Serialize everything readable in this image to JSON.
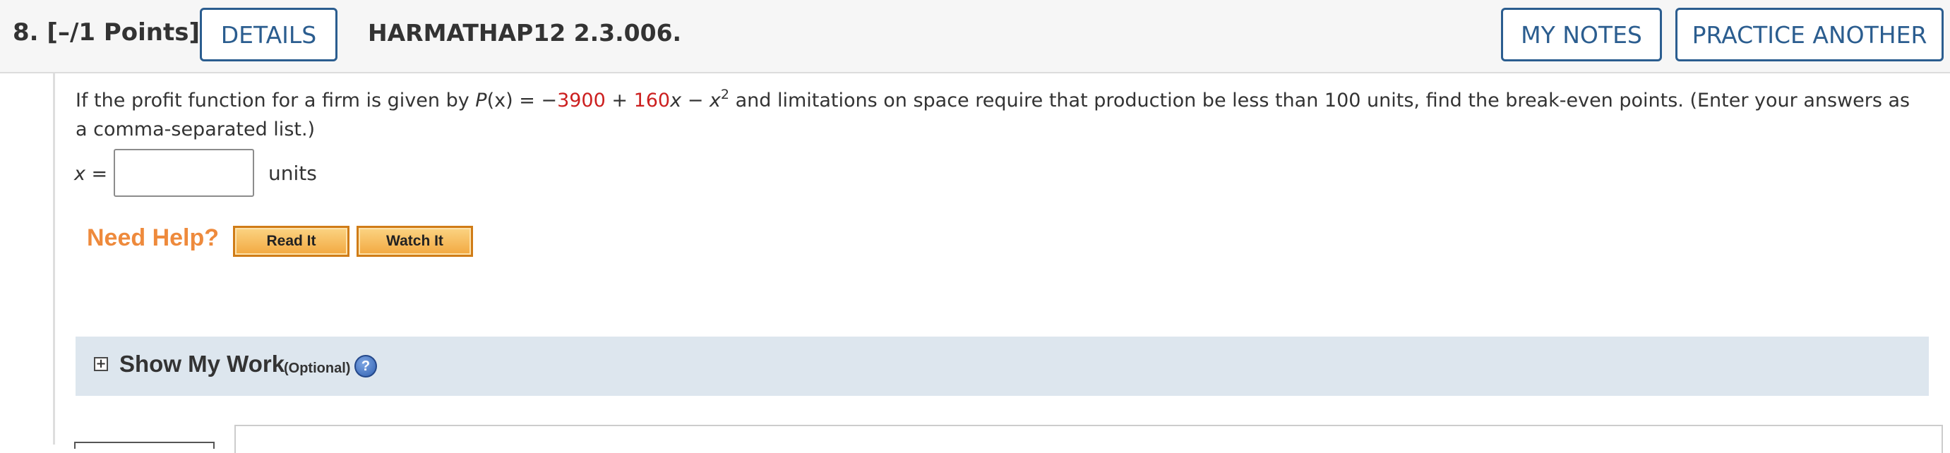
{
  "header": {
    "question_number": "8.",
    "points": "[–/1 Points]",
    "details_label": "DETAILS",
    "assignment_code": "HARMATHAP12 2.3.006.",
    "my_notes_label": "MY NOTES",
    "practice_another_label": "PRACTICE ANOTHER"
  },
  "question": {
    "text_1": "If the profit function for a firm is given by ",
    "func_name": "P",
    "func_arg": "(x) = −",
    "constant": "3900",
    "plus": " + ",
    "coefficient": "160",
    "var_x": "x",
    "minus": " − ",
    "var_x2": "x",
    "exponent": "2",
    "text_2": " and limitations on space require that production be less than 100 units, find the break-even points. (Enter your answers as a comma-separated list.)"
  },
  "answer": {
    "variable_label": "x =",
    "input_value": "",
    "units_label": "units"
  },
  "help": {
    "need_help_label": "Need Help?",
    "read_it_label": "Read It",
    "watch_it_label": "Watch It"
  },
  "show_my_work": {
    "expand_icon": "+",
    "title": "Show My Work",
    "optional_label": "(Optional)",
    "help_icon": "?"
  },
  "colors": {
    "accent_blue": "#2b5d8f",
    "value_red": "#cc1f1f",
    "need_help_orange": "#ee8a3c",
    "button_orange": "#f2a840",
    "show_work_bg": "#dde6ee"
  }
}
